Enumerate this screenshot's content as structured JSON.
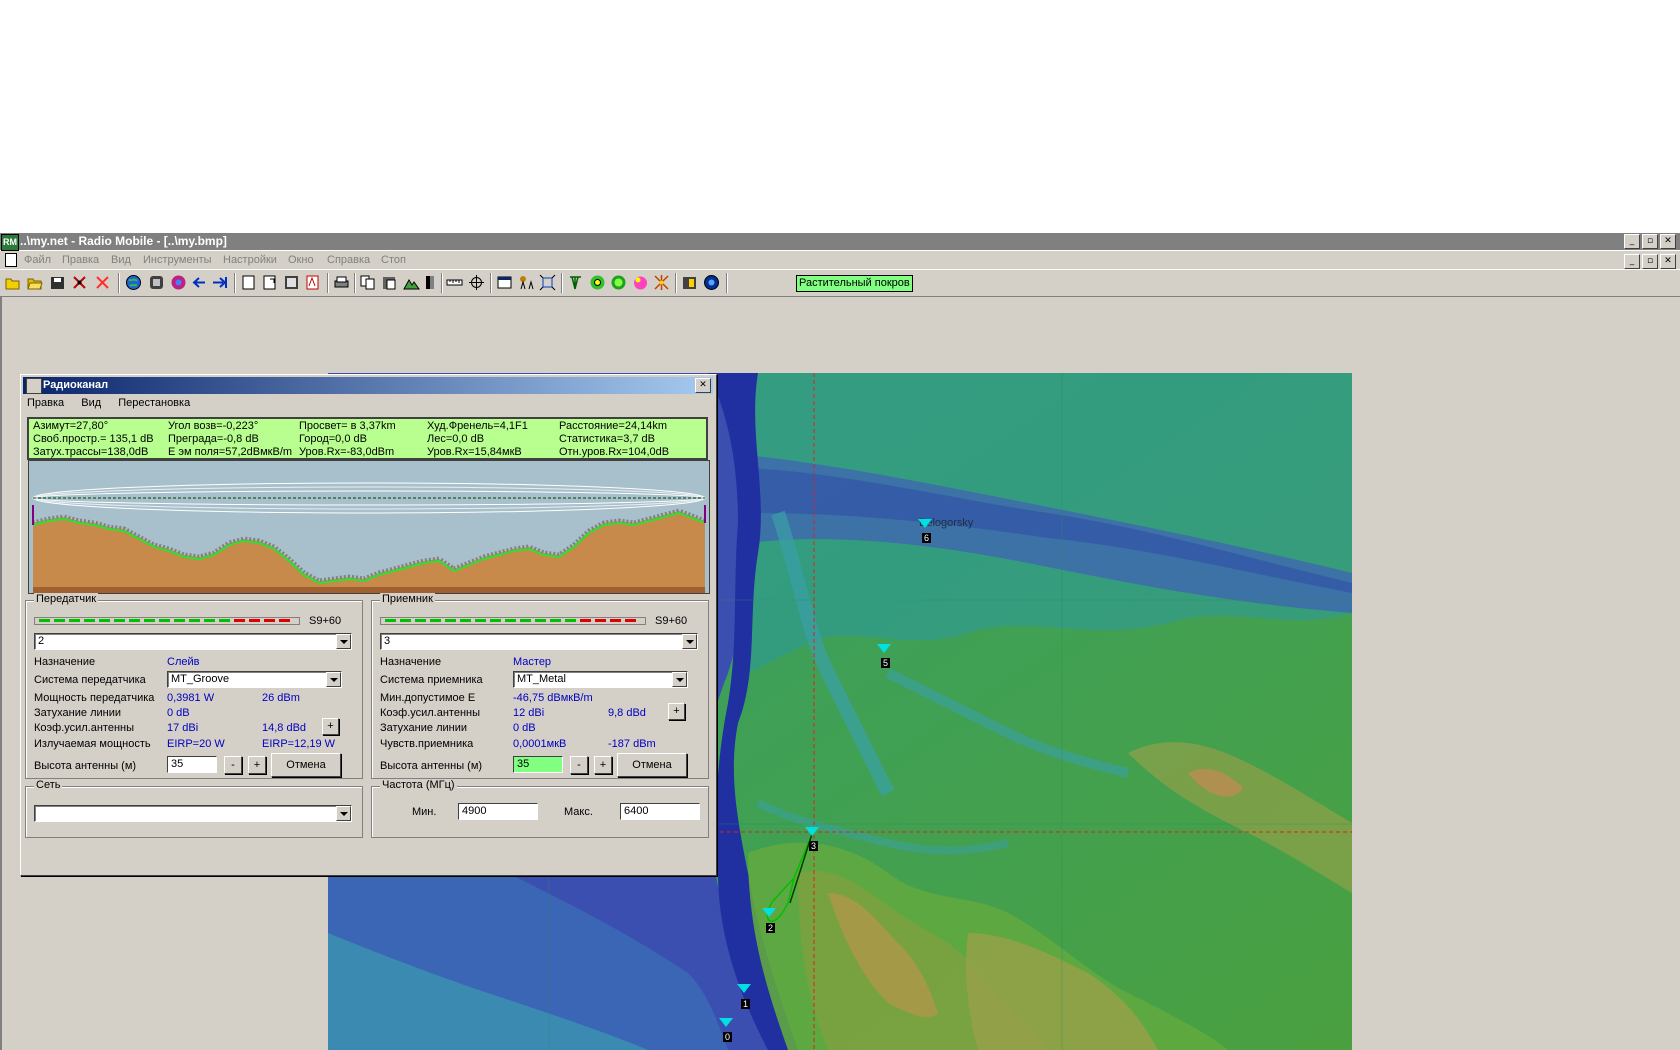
{
  "window": {
    "title": "..\\my.net - Radio Mobile - [..\\my.bmp]",
    "app_icon_label": "RM"
  },
  "menu": {
    "items": [
      "Файл",
      "Правка",
      "Вид",
      "Инструменты",
      "Настройки",
      "Окно",
      "Справка",
      "Стоп"
    ]
  },
  "toolbar": {
    "vegetation_label": "Растительный покров"
  },
  "dialog": {
    "title": "Радиоканал",
    "menu": [
      "Правка",
      "Вид",
      "Перестановка"
    ],
    "stats": [
      [
        "Азимут=27,80°",
        "Угол возв=-0,223°",
        "Просвет= в 3,37km",
        "Худ.Френель=4,1F1",
        "Расстояние=24,14km"
      ],
      [
        "Своб.простр.= 135,1 dB",
        "Преграда=-0,8 dB",
        "Город=0,0 dB",
        "Лес=0,0 dB",
        "Статистика=3,7 dB"
      ],
      [
        "Затух.трассы=138,0dB",
        "Е эм поля=57,2dBмкВ/m",
        "Уров.Rx=-83,0dBm",
        "Уров.Rx=15,84мкВ",
        "Отн.уров.Rx=104,0dB"
      ]
    ],
    "transmitter": {
      "group_label": "Передатчик",
      "meter_label": "S9+60",
      "unit": "2",
      "role_label": "Назначение",
      "role_value": "Слейв",
      "system_label": "Система передатчика",
      "system_value": "MT_Groove",
      "power_label": "Мощность передатчика",
      "power_w": "0,3981 W",
      "power_dbm": "26 dBm",
      "loss_label": "Затухание линии",
      "loss_value": "0 dB",
      "gain_label": "Коэф.усил.антенны",
      "gain_dbi": "17 dBi",
      "gain_dbd": "14,8 dBd",
      "eirp_label": "Излучаемая мощность",
      "eirp": "EIRP=20 W",
      "erp": "EIRP=12,19 W",
      "height_label": "Высота антенны (м)",
      "height_value": "35",
      "minus": "-",
      "plus": "+",
      "cancel": "Отмена"
    },
    "receiver": {
      "group_label": "Приемник",
      "meter_label": "S9+60",
      "unit": "3",
      "role_label": "Назначение",
      "role_value": "Мастер",
      "system_label": "Система приемника",
      "system_value": "MT_Metal",
      "minfield_label": "Мин.допустимое Е",
      "minfield_value": "-46,75 dBмкВ/m",
      "gain_label": "Коэф.усил.антенны",
      "gain_dbi": "12 dBi",
      "gain_dbd": "9,8 dBd",
      "loss_label": "Затухание линии",
      "loss_value": "0 dB",
      "sens_label": "Чувств.приемника",
      "sens_uv": "0,0001мкВ",
      "sens_dbm": "-187 dBm",
      "height_label": "Высота антенны (м)",
      "height_value": "35",
      "minus": "-",
      "plus": "+",
      "cancel": "Отмена"
    },
    "network": {
      "group_label": "Сеть",
      "value": ""
    },
    "frequency": {
      "group_label": "Частота (МГц)",
      "min_label": "Мин.",
      "min_value": "4900",
      "max_label": "Макс.",
      "max_value": "6400"
    },
    "gain_plus": "+"
  },
  "map": {
    "city_label": "Belogorsky",
    "units": [
      "0",
      "1",
      "2",
      "3",
      "5",
      "6"
    ]
  },
  "colors": {
    "stats_bg": "#b8ff90",
    "value_blue": "#0000c0",
    "unit_marker": "#00e0e0",
    "link_green": "#00c000"
  }
}
